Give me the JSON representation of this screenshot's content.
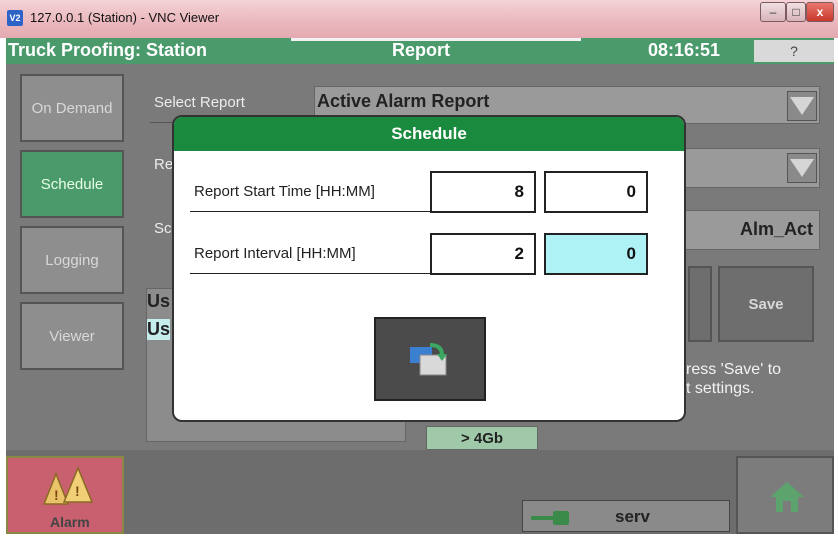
{
  "window": {
    "title": "127.0.0.1 (Station) - VNC Viewer",
    "icon": "V2"
  },
  "window_controls": {
    "minimize": "–",
    "maximize": "□",
    "close": "x"
  },
  "header": {
    "title": "Truck Proofing: Station",
    "section": "Report",
    "time": "08:16:51",
    "help": "?"
  },
  "sidebar": [
    {
      "label": "On Demand"
    },
    {
      "label": "Schedule"
    },
    {
      "label": "Logging"
    },
    {
      "label": "Viewer"
    }
  ],
  "form": {
    "select_report_label": "Select Report",
    "select_report_value": "Active Alarm Report",
    "row2_label": "Re",
    "row3_label": "Sc",
    "row3_value": "Alm_Act",
    "list_item_1": "Us",
    "list_item_2": "Us",
    "save_button": "Save",
    "save_hint": "ress 'Save' to\nt settings.",
    "disk_free": "> 4Gb"
  },
  "bottom": {
    "alarm_label": "Alarm",
    "user": "serv"
  },
  "dialog": {
    "title": "Schedule",
    "start_time_label": "Report Start Time [HH:MM]",
    "start_hh": "8",
    "start_mm": "0",
    "interval_label": "Report Interval [HH:MM]",
    "interval_hh": "2",
    "interval_mm": "0"
  },
  "colors": {
    "header_green": "#4a9a6c",
    "dialog_green": "#1a8a3e",
    "selected_field": "#aef2f6",
    "alarm_red": "#c86070"
  }
}
